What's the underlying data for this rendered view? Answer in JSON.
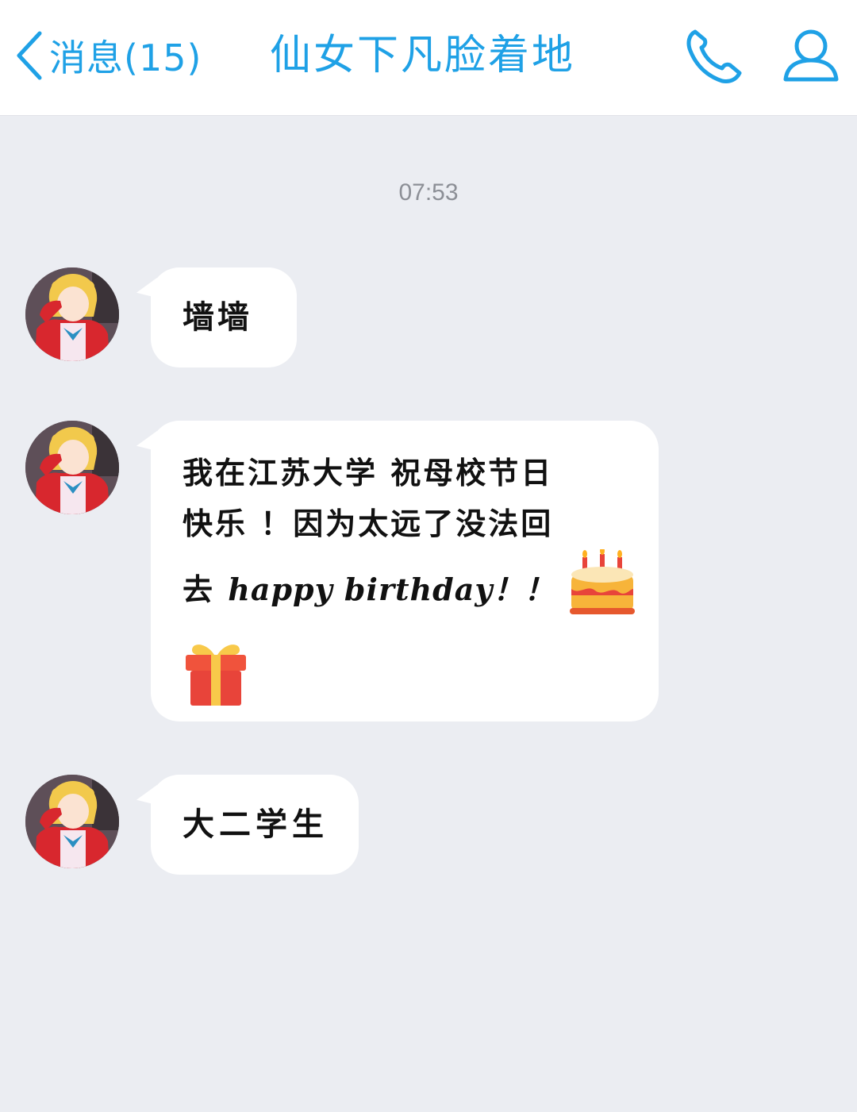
{
  "header": {
    "back_label": "消息(15)",
    "title": "仙女下凡脸着地",
    "icons": [
      "chevron-left-icon",
      "phone-icon",
      "profile-icon"
    ]
  },
  "timestamp": "07:53",
  "messages": [
    {
      "text": "墙墙"
    },
    {
      "lines": [
        "我在江苏大学 祝母校节日",
        "快乐 ！因为太远了没法回",
        "去 ",
        "happy birthday！！"
      ],
      "emojis": [
        "birthday-cake-icon",
        "gift-icon"
      ]
    },
    {
      "text": "大二学生"
    }
  ],
  "colors": {
    "accent": "#1fa1e6",
    "chat_background": "#ebedf2",
    "bubble": "#ffffff",
    "timestamp": "#8c8f96"
  }
}
